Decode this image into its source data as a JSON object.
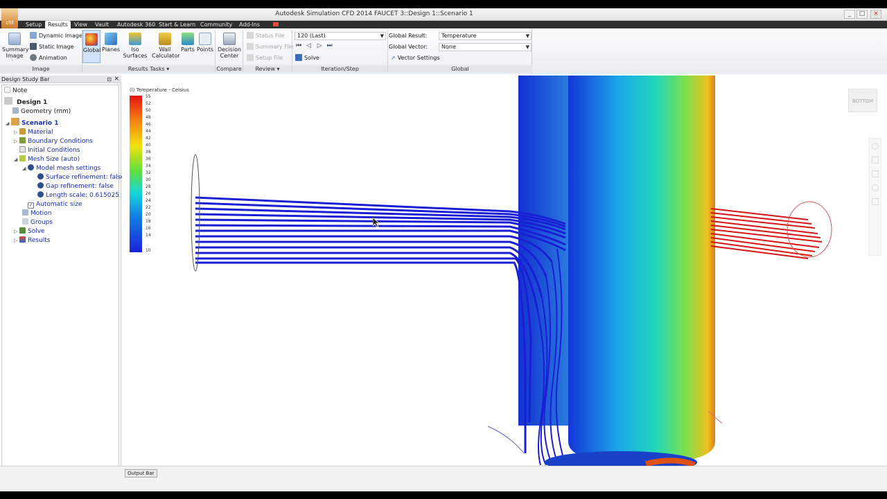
{
  "window": {
    "title": "Autodesk Simulation CFD 2014   FAUCET 3::Design 1::Scenario 1",
    "app_badge": "cfd",
    "controls": [
      "_",
      "□",
      "×"
    ]
  },
  "tabs": [
    "Setup",
    "Results",
    "View",
    "Vault",
    "Autodesk 360",
    "Start & Learn",
    "Community",
    "Add-Ins"
  ],
  "active_tab": "Results",
  "ribbon": {
    "image_group": {
      "label": "Image",
      "summary_image": "Summary Image",
      "dynamic_image": "Dynamic Image",
      "static_image": "Static Image",
      "animation": "Animation"
    },
    "results_tasks": {
      "label": "Results Tasks",
      "buttons": [
        "Global",
        "Planes",
        "Iso Surfaces",
        "Wall Calculator",
        "Parts",
        "Points"
      ]
    },
    "compare": {
      "label": "Compare",
      "decision_center": "Decision Center"
    },
    "review": {
      "label": "Review",
      "status_file": "Status File",
      "summary_file": "Summary File",
      "setup_file": "Setup File"
    },
    "iteration": {
      "label": "Iteration/Step",
      "combo_value": "120 (Last)",
      "solve": "Solve"
    },
    "global": {
      "label": "Global",
      "global_result_label": "Global Result:",
      "global_result_value": "Temperature",
      "global_vector_label": "Global Vector:",
      "global_vector_value": "None",
      "vector_settings": "Vector Settings"
    }
  },
  "design_study_bar": {
    "title": "Design Study Bar",
    "items": [
      {
        "label": "Note"
      },
      {
        "label": "Design 1"
      },
      {
        "label": "Geometry (mm)"
      },
      {
        "label": "Scenario 1"
      },
      {
        "label": "Material"
      },
      {
        "label": "Boundary Conditions"
      },
      {
        "label": "Initial Conditions"
      },
      {
        "label": "Mesh Size (auto)"
      },
      {
        "label": "Model mesh settings"
      },
      {
        "label": "Surface refinement: false"
      },
      {
        "label": "Gap refinement: false"
      },
      {
        "label": "Length scale: 0.615025"
      },
      {
        "label": "Automatic size"
      },
      {
        "label": "Motion"
      },
      {
        "label": "Groups"
      },
      {
        "label": "Solve"
      },
      {
        "label": "Results"
      }
    ]
  },
  "legend": {
    "title": "(i) Temperature - Celsius",
    "ticks": [
      "55",
      "52",
      "50",
      "48",
      "46",
      "44",
      "42",
      "40",
      "38",
      "36",
      "34",
      "32",
      "30",
      "28",
      "26",
      "24",
      "22",
      "20",
      "18",
      "16",
      "14",
      "10"
    ]
  },
  "viewcube_label": "BOTTOM",
  "output_bar": "Output Bar",
  "colors": {
    "cold": "#1a22d8",
    "hot": "#e01a1a",
    "ribbon_dark": "#2f2f2f"
  }
}
